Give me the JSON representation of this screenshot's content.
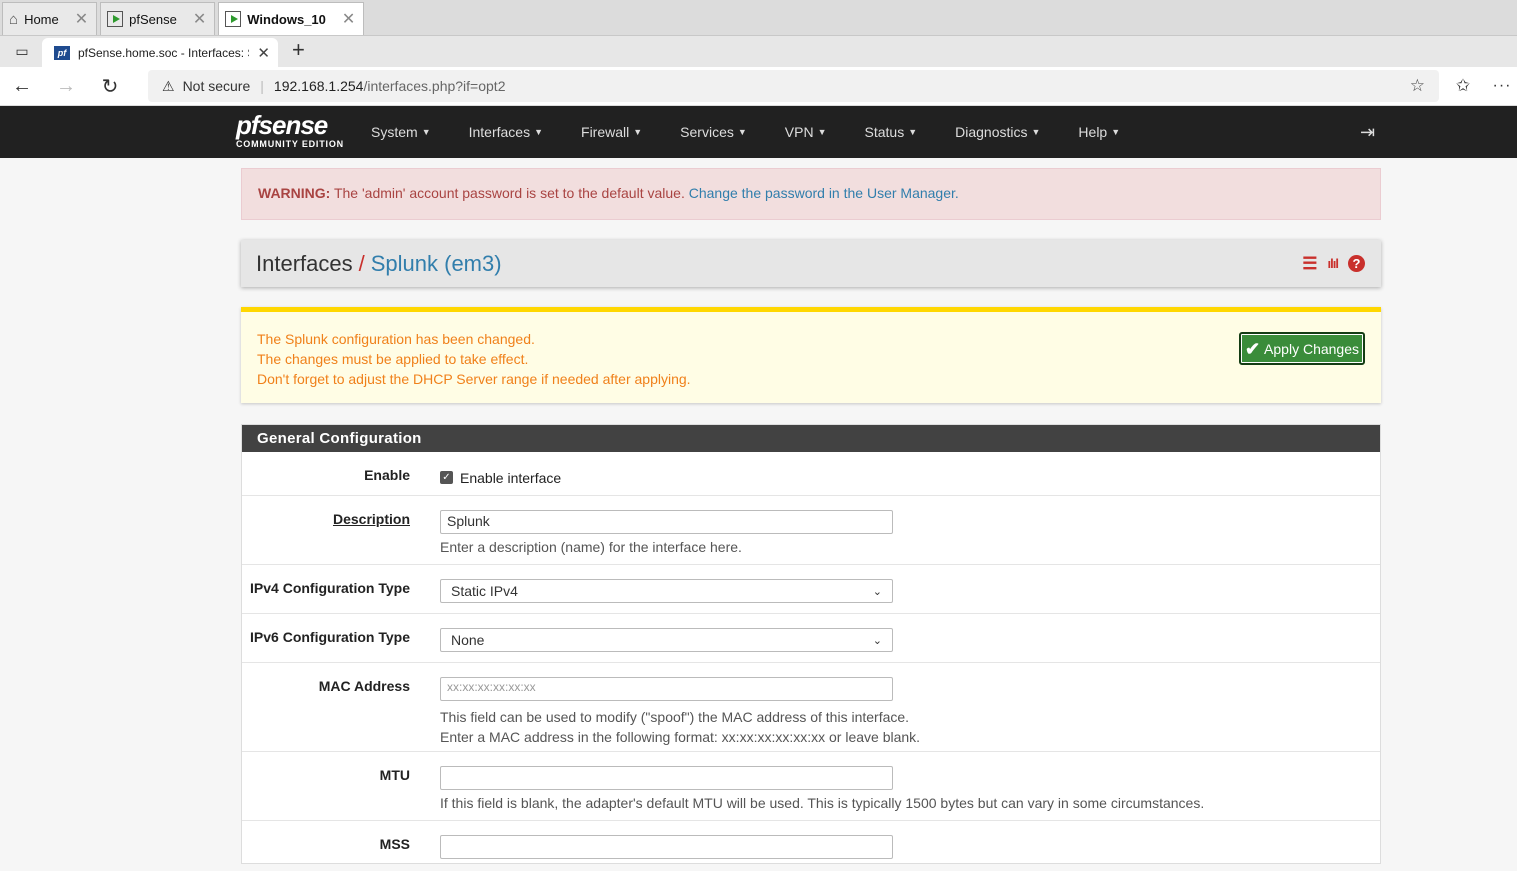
{
  "vm_tabs": [
    {
      "label": "Home"
    },
    {
      "label": "pfSense"
    },
    {
      "label": "Windows_10"
    }
  ],
  "browser": {
    "tab_title": "pfSense.home.soc - Interfaces: Sp",
    "address": {
      "security_label": "Not secure",
      "host": "192.168.1.254",
      "path": "/interfaces.php?if=opt2"
    }
  },
  "pfsense": {
    "logo_main": "pfsense",
    "logo_sub": "COMMUNITY EDITION",
    "menu": [
      "System",
      "Interfaces",
      "Firewall",
      "Services",
      "VPN",
      "Status",
      "Diagnostics",
      "Help"
    ]
  },
  "warning_alert": {
    "prefix": "WARNING:",
    "text": " The 'admin' account password is set to the default value. ",
    "link": "Change the password in the User Manager."
  },
  "page_header": {
    "section": "Interfaces",
    "separator": "/",
    "current": "Splunk (em3)"
  },
  "changes_alert": {
    "lines": [
      "The Splunk configuration has been changed.",
      "The changes must be applied to take effect.",
      "Don't forget to adjust the DHCP Server range if needed after applying."
    ],
    "apply_label": "Apply Changes"
  },
  "general_config": {
    "heading": "General Configuration",
    "enable": {
      "label": "Enable",
      "checkbox_label": "Enable interface",
      "checked": true
    },
    "description": {
      "label": "Description",
      "value": "Splunk",
      "help": "Enter a description (name) for the interface here."
    },
    "ipv4_type": {
      "label": "IPv4 Configuration Type",
      "value": "Static IPv4"
    },
    "ipv6_type": {
      "label": "IPv6 Configuration Type",
      "value": "None"
    },
    "mac": {
      "label": "MAC Address",
      "placeholder": "xx:xx:xx:xx:xx:xx",
      "help1": "This field can be used to modify (\"spoof\") the MAC address of this interface.",
      "help2": "Enter a MAC address in the following format: xx:xx:xx:xx:xx:xx or leave blank."
    },
    "mtu": {
      "label": "MTU",
      "value": "",
      "help": "If this field is blank, the adapter's default MTU will be used. This is typically 1500 bytes but can vary in some circumstances."
    },
    "mss": {
      "label": "MSS",
      "value": ""
    }
  }
}
